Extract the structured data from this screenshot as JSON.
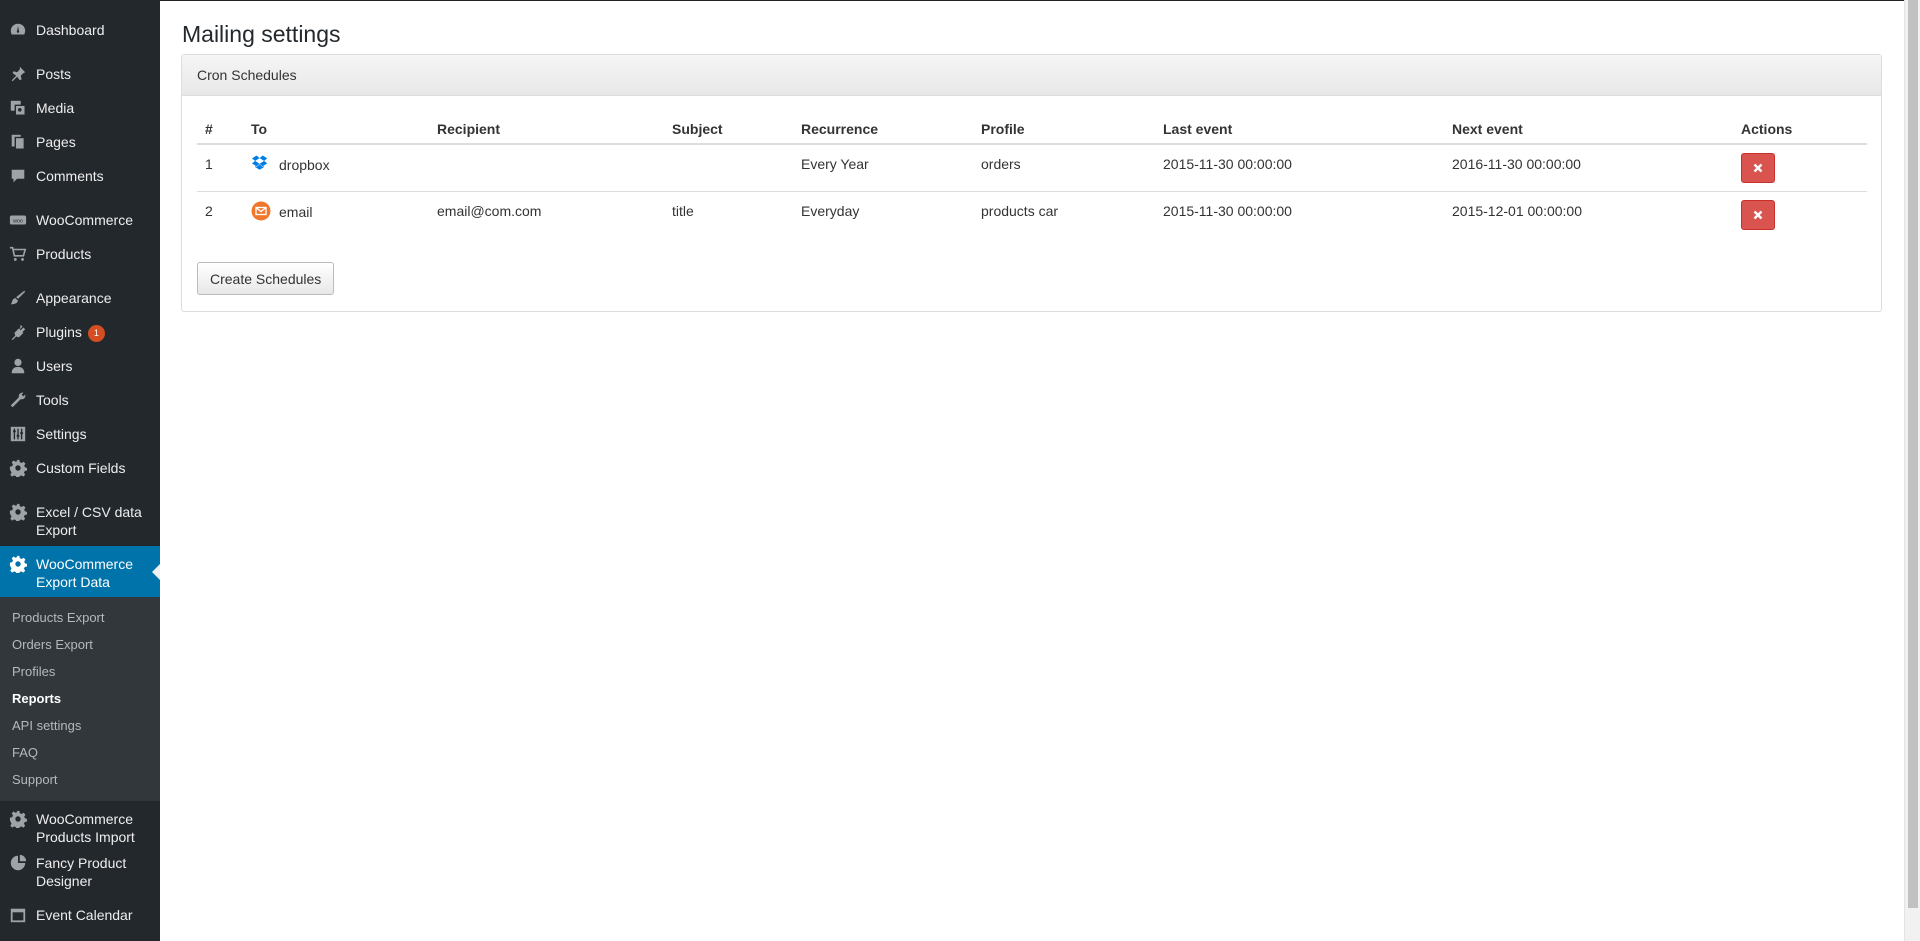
{
  "sidebar": {
    "items": [
      {
        "label": "Dashboard",
        "icon": "dashboard-icon"
      },
      {
        "label": "Posts",
        "icon": "pin-icon"
      },
      {
        "label": "Media",
        "icon": "media-icon"
      },
      {
        "label": "Pages",
        "icon": "pages-icon"
      },
      {
        "label": "Comments",
        "icon": "comment-icon"
      },
      {
        "label": "WooCommerce",
        "icon": "woo-icon"
      },
      {
        "label": "Products",
        "icon": "cart-icon"
      },
      {
        "label": "Appearance",
        "icon": "brush-icon"
      },
      {
        "label": "Plugins",
        "icon": "plug-icon",
        "badge": "1"
      },
      {
        "label": "Users",
        "icon": "user-icon"
      },
      {
        "label": "Tools",
        "icon": "wrench-icon"
      },
      {
        "label": "Settings",
        "icon": "sliders-icon"
      },
      {
        "label": "Custom Fields",
        "icon": "gear-icon"
      },
      {
        "label": "Excel / CSV data Export",
        "icon": "gear-icon"
      },
      {
        "label": "WooCommerce Export Data",
        "icon": "gear-icon"
      },
      {
        "label": "WooCommerce Products Import",
        "icon": "gear-icon"
      },
      {
        "label": "Fancy Product Designer",
        "icon": "pie-icon"
      },
      {
        "label": "Event Calendar",
        "icon": "calendar-icon"
      }
    ],
    "submenu": [
      {
        "label": "Products Export"
      },
      {
        "label": "Orders Export"
      },
      {
        "label": "Profiles"
      },
      {
        "label": "Reports"
      },
      {
        "label": "API settings"
      },
      {
        "label": "FAQ"
      },
      {
        "label": "Support"
      }
    ]
  },
  "main": {
    "title": "Mailing settings",
    "panel_heading": "Cron Schedules",
    "columns": [
      "#",
      "To",
      "Recipient",
      "Subject",
      "Recurrence",
      "Profile",
      "Last event",
      "Next event",
      "Actions"
    ],
    "rows": [
      {
        "num": "1",
        "to": "dropbox",
        "to_icon": "dropbox-icon",
        "recipient": "",
        "subject": "",
        "recurrence": "Every Year",
        "profile": "orders",
        "last_event": "2015-11-30 00:00:00",
        "next_event": "2016-11-30 00:00:00"
      },
      {
        "num": "2",
        "to": "email",
        "to_icon": "email-icon",
        "recipient": "email@com.com",
        "subject": "title",
        "recurrence": "Everyday",
        "profile": "products car",
        "last_event": "2015-11-30 00:00:00",
        "next_event": "2015-12-01 00:00:00"
      }
    ],
    "create_button": "Create Schedules"
  },
  "colors": {
    "sidebar_bg": "#23282d",
    "active_bg": "#0073aa",
    "badge": "#d54e21",
    "delete_button": "#d9534f",
    "dropbox": "#007ee5",
    "email": "#f0782d"
  }
}
